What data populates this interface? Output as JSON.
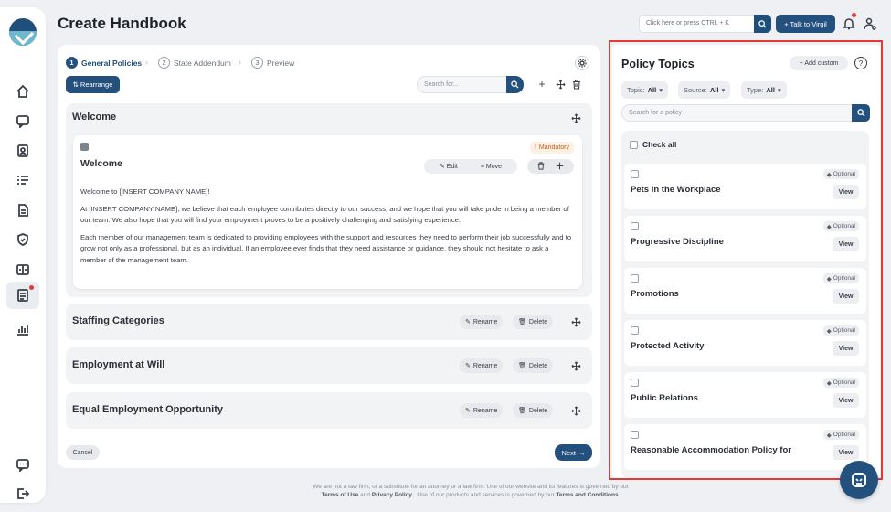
{
  "header": {
    "title": "Create Handbook",
    "search_placeholder": "Click here or press CTRL + K",
    "talk_button": "+ Talk to Virgil"
  },
  "steps": [
    {
      "num": "1",
      "label": "General Policies"
    },
    {
      "num": "2",
      "label": "State Addendum"
    },
    {
      "num": "3",
      "label": "Preview"
    }
  ],
  "toolbar": {
    "rearrange": "Rearrange",
    "search_placeholder": "Search for..."
  },
  "welcome_section": {
    "title": "Welcome",
    "card": {
      "badge": "Mandatory",
      "title": "Welcome",
      "edit": "Edit",
      "move": "Move",
      "paragraphs": [
        "Welcome to [INSERT COMPANY NAME]!",
        "At [INSERT COMPANY NAME], we believe that each employee contributes directly to our success, and we hope that you will take pride in being a member of our team. We also hope that you will find your employment proves to be a positively challenging and satisfying experience.",
        "Each member of our management team is dedicated to providing employees with the support and resources they need to perform their job successfully and to grow not only as a professional, but as an individual. If an employee ever finds that they need assistance or guidance, they should not hesitate to ask a member of the management team."
      ]
    }
  },
  "sections": [
    {
      "title": "Staffing Categories",
      "rename": "Rename",
      "delete": "Delete"
    },
    {
      "title": "Employment at Will",
      "rename": "Rename",
      "delete": "Delete"
    },
    {
      "title": "Equal Employment Opportunity",
      "rename": "Rename",
      "delete": "Delete"
    }
  ],
  "actions": {
    "cancel": "Cancel",
    "next": "Next"
  },
  "footer": {
    "line1": "We are not a law firm, or a substitute for an attorney or a law firm. Use of our website and its features is governed by our",
    "terms": "Terms of Use",
    "and": "and",
    "privacy": "Privacy Policy",
    "line2": ". Use of our products and services is governed by our",
    "conditions": "Terms and Conditions."
  },
  "topics": {
    "title": "Policy Topics",
    "add_custom": "+ Add custom",
    "help": "?",
    "filters": [
      {
        "label": "Topic:",
        "value": "All"
      },
      {
        "label": "Source:",
        "value": "All"
      },
      {
        "label": "Type:",
        "value": "All"
      }
    ],
    "search_placeholder": "Search for a policy",
    "check_all": "Check all",
    "items": [
      {
        "name": "Pets in the Workplace",
        "badge": "Optional",
        "view": "View"
      },
      {
        "name": "Progressive Discipline",
        "badge": "Optional",
        "view": "View"
      },
      {
        "name": "Promotions",
        "badge": "Optional",
        "view": "View"
      },
      {
        "name": "Protected Activity",
        "badge": "Optional",
        "view": "View"
      },
      {
        "name": "Public Relations",
        "badge": "Optional",
        "view": "View"
      },
      {
        "name": "Reasonable Accommodation Policy for",
        "badge": "Optional",
        "view": "View"
      }
    ]
  },
  "colors": {
    "accent": "#24507d",
    "highlight": "#e53935",
    "mandatory": "#c55f14"
  }
}
